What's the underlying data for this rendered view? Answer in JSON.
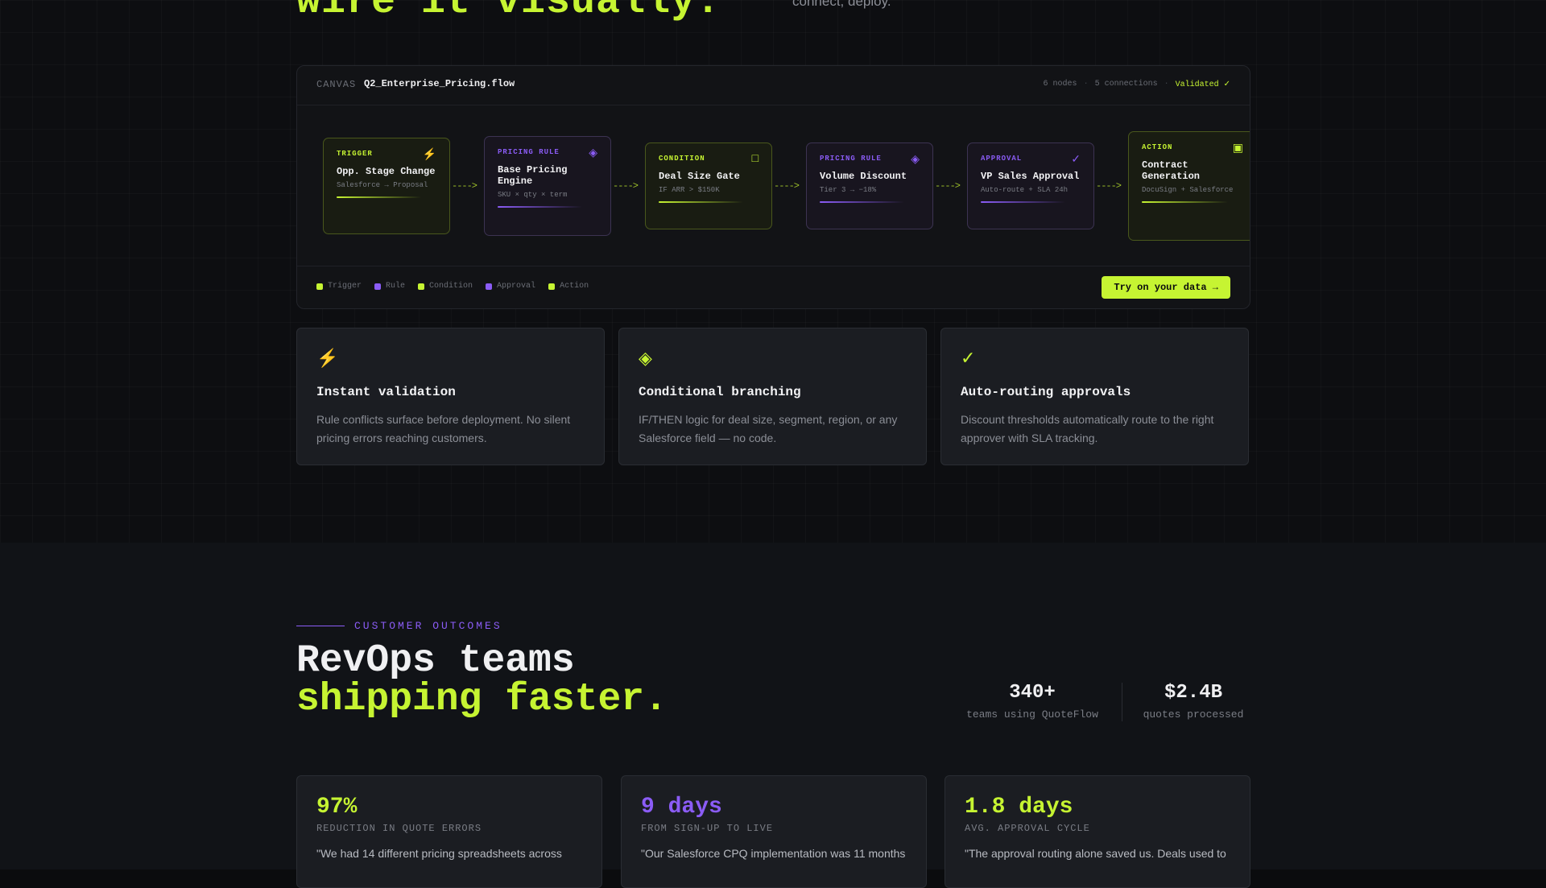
{
  "hero": {
    "title_fragment": "wire it visually.",
    "subtitle_fragment": "connect, deploy."
  },
  "canvas": {
    "label": "CANVAS",
    "file": "Q2_Enterprise_Pricing.flow",
    "nodes_count": "6 nodes",
    "connections": "5 connections",
    "status": "Validated ✓",
    "nodes": [
      {
        "type": "TRIGGER",
        "title": "Opp. Stage Change",
        "sub": "Salesforce → Proposal",
        "icon": "⚡",
        "icon_name": "lightning-icon",
        "color": "lime"
      },
      {
        "type": "PRICING RULE",
        "title": "Base Pricing Engine",
        "sub": "SKU × qty × term",
        "icon": "◈",
        "icon_name": "diamond-icon",
        "color": "purple"
      },
      {
        "type": "CONDITION",
        "title": "Deal Size Gate",
        "sub": "IF ARR > $150K",
        "icon": "□",
        "icon_name": "square-icon",
        "color": "lime"
      },
      {
        "type": "PRICING RULE",
        "title": "Volume Discount",
        "sub": "Tier 3 → −18%",
        "icon": "◈",
        "icon_name": "diamond-icon",
        "color": "purple"
      },
      {
        "type": "APPROVAL",
        "title": "VP Sales Approval",
        "sub": "Auto-route + SLA 24h",
        "icon": "✓",
        "icon_name": "check-icon",
        "color": "purple"
      },
      {
        "type": "ACTION",
        "title": "Contract Generation",
        "sub": "DocuSign + Salesforce",
        "icon": "▣",
        "icon_name": "document-icon",
        "color": "lime"
      }
    ],
    "connector": "---->",
    "legend": [
      {
        "label": "Trigger",
        "color": "lime"
      },
      {
        "label": "Rule",
        "color": "purple"
      },
      {
        "label": "Condition",
        "color": "lime"
      },
      {
        "label": "Approval",
        "color": "purple"
      },
      {
        "label": "Action",
        "color": "lime"
      }
    ],
    "cta": "Try on your data →"
  },
  "features": [
    {
      "icon": "⚡",
      "icon_name": "lightning-icon",
      "title": "Instant validation",
      "desc": "Rule conflicts surface before deployment. No silent pricing errors reaching customers."
    },
    {
      "icon": "◈",
      "icon_name": "diamond-icon",
      "title": "Conditional branching",
      "desc": "IF/THEN logic for deal size, segment, region, or any Salesforce field — no code."
    },
    {
      "icon": "✓",
      "icon_name": "check-icon",
      "title": "Auto-routing approvals",
      "desc": "Discount thresholds automatically route to the right approver with SLA tracking."
    }
  ],
  "outcomes": {
    "eyebrow": "CUSTOMER OUTCOMES",
    "headline_1": "RevOps teams",
    "headline_2": "shipping faster.",
    "stats": [
      {
        "value": "340+",
        "label": "teams using QuoteFlow"
      },
      {
        "value": "$2.4B",
        "label": "quotes processed"
      }
    ],
    "cards": [
      {
        "value": "97%",
        "label": "REDUCTION IN QUOTE ERRORS",
        "quote": "\"We had 14 different pricing spreadsheets across",
        "color": "lime"
      },
      {
        "value": "9 days",
        "label": "FROM SIGN-UP TO LIVE",
        "quote": "\"Our Salesforce CPQ implementation was 11 months",
        "color": "purple"
      },
      {
        "value": "1.8 days",
        "label": "AVG. APPROVAL CYCLE",
        "quote": "\"The approval routing alone saved us. Deals used to",
        "color": "lime"
      }
    ]
  },
  "colors": {
    "accent_lime": "#c6f432",
    "accent_purple": "#8b5cf6",
    "background": "#0b0c0e"
  }
}
